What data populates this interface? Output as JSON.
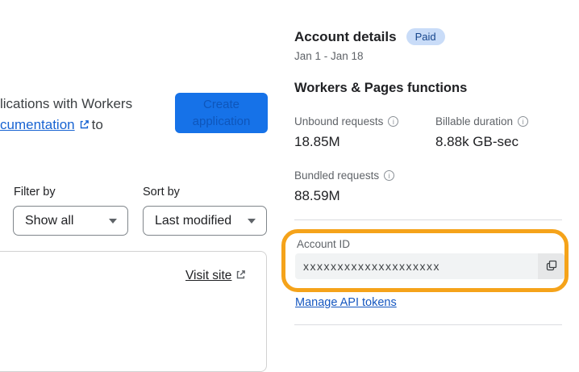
{
  "left": {
    "intro_line1": "lications with Workers",
    "intro_link_text": "cumentation",
    "intro_suffix": "to",
    "create_button": {
      "line1": "Create",
      "line2": "application"
    },
    "filter_label": "Filter by",
    "filter_value": "Show all",
    "sort_label": "Sort by",
    "sort_value": "Last modified",
    "visit_site_label": "Visit site"
  },
  "account": {
    "title": "Account details",
    "badge": "Paid",
    "date_range": "Jan 1 - Jan 18",
    "section_title": "Workers & Pages functions",
    "stats": [
      {
        "label": "Unbound requests",
        "value": "18.85M"
      },
      {
        "label": "Billable duration",
        "value": "8.88k GB-sec"
      },
      {
        "label": "Bundled requests",
        "value": "88.59M"
      }
    ],
    "account_id": {
      "label": "Account ID",
      "value": "xxxxxxxxxxxxxxxxxxxx"
    },
    "manage_link_label": "Manage API tokens"
  },
  "colors": {
    "button_blue": "#1672e8",
    "link_blue": "#1763d2",
    "badge_bg": "#c9dcf8",
    "badge_text": "#16458c",
    "highlight_orange": "#f5a31a"
  }
}
